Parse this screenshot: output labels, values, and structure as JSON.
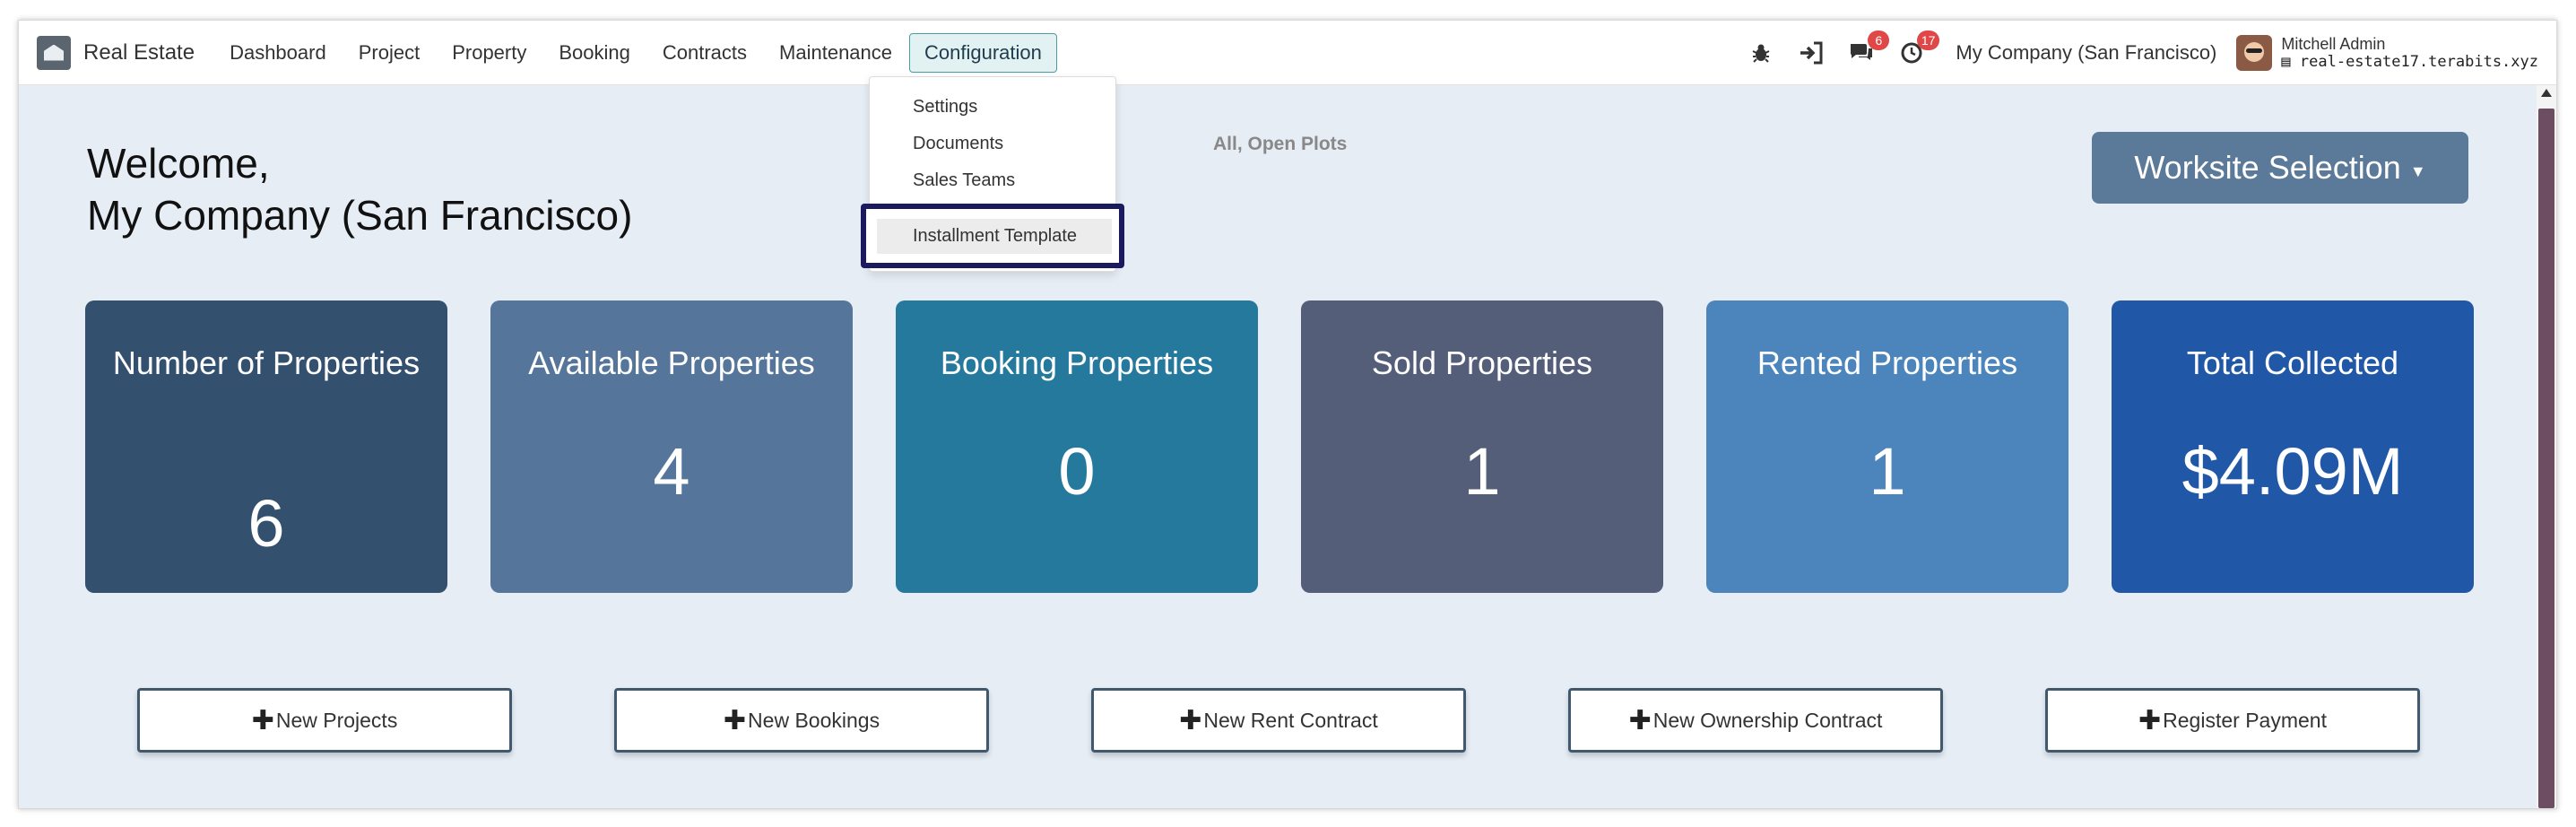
{
  "navbar": {
    "brand": "Real Estate",
    "menu": [
      "Dashboard",
      "Project",
      "Property",
      "Booking",
      "Contracts",
      "Maintenance",
      "Configuration"
    ],
    "active_menu": "Configuration",
    "icons": {
      "debug": "bug-icon",
      "switch": "sign-in-icon",
      "messages": "chat-icon",
      "activities": "clock-icon"
    },
    "messages_badge": "6",
    "activities_badge": "17",
    "company": "My Company (San Francisco)",
    "user_name": "Mitchell Admin",
    "database": "real-estate17.terabits.xyz"
  },
  "dropdown": {
    "items": [
      "Settings",
      "Documents",
      "Sales Teams",
      "Installment Template"
    ]
  },
  "welcome": {
    "line1": "Welcome,",
    "line2": "My Company (San Francisco)"
  },
  "filter_text": "All, Open Plots",
  "worksite_button": "Worksite Selection",
  "cards": [
    {
      "title": "Number of Properties",
      "value": "6",
      "color": "#33506e"
    },
    {
      "title": "Available Properties",
      "value": "4",
      "color": "#55769a"
    },
    {
      "title": "Booking Properties",
      "value": "0",
      "color": "#25799c"
    },
    {
      "title": "Sold Properties",
      "value": "1",
      "color": "#545e78"
    },
    {
      "title": "Rented Properties",
      "value": "1",
      "color": "#4c85bc"
    },
    {
      "title": "Total Collected",
      "value": "$4.09M",
      "color": "#2057a6"
    }
  ],
  "actions": [
    "New Projects",
    "New Bookings",
    "New Rent Contract",
    "New Ownership Contract",
    "Register Payment"
  ]
}
